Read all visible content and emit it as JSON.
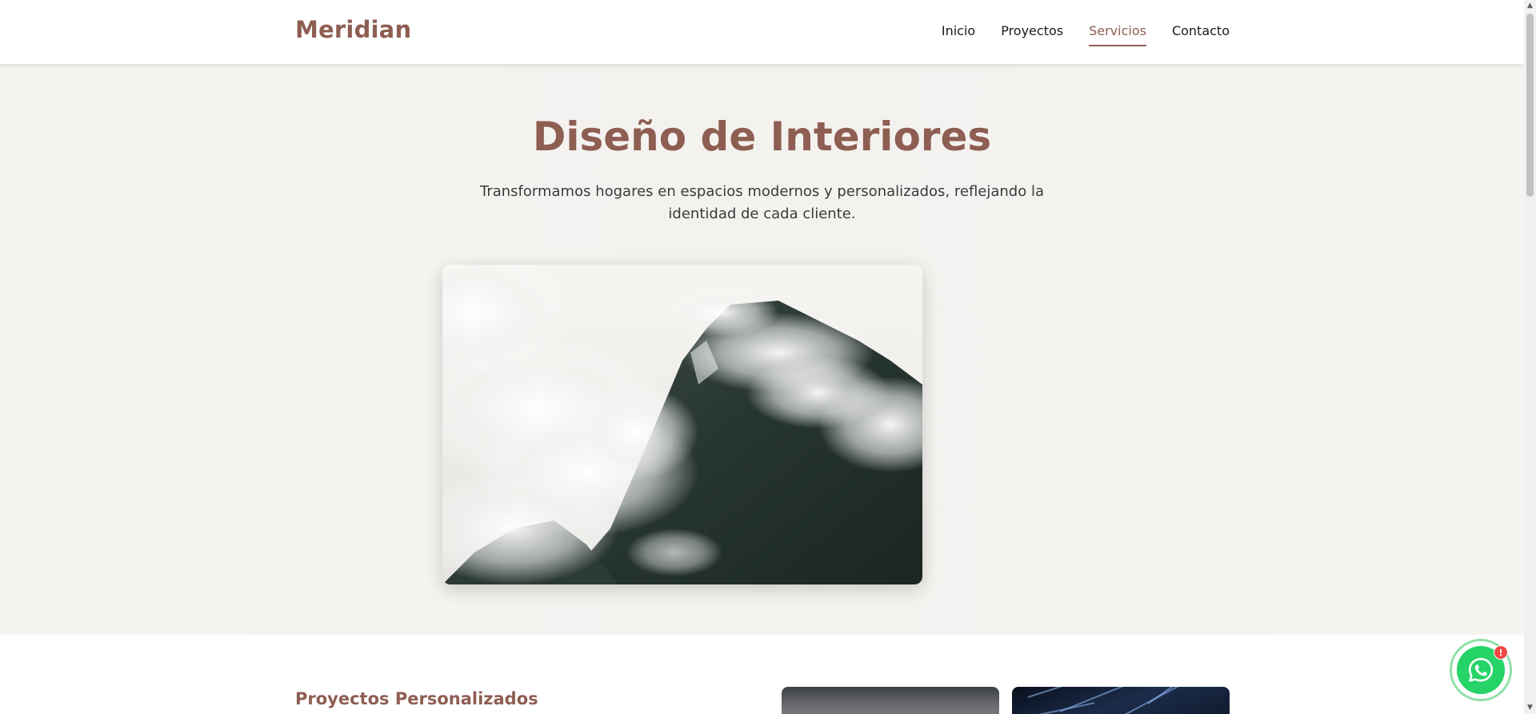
{
  "brand": {
    "name": "Meridian",
    "color": "#8e5e52"
  },
  "nav": {
    "items": [
      {
        "label": "Inicio",
        "active": false
      },
      {
        "label": "Proyectos",
        "active": false
      },
      {
        "label": "Servicios",
        "active": true
      },
      {
        "label": "Contacto",
        "active": false
      }
    ]
  },
  "hero": {
    "title": "Diseño de Interiores",
    "subtitle": "Transformamos hogares en espacios modernos y personalizados, reflejando la identidad de cada cliente."
  },
  "projects": {
    "heading": "Proyectos Personalizados"
  },
  "whatsapp": {
    "icon": "whatsapp-icon",
    "badge": "!",
    "color": "#25d366",
    "badge_color": "#ef4444"
  },
  "scrollbar": {
    "up_arrow": "▲",
    "down_arrow": "▼"
  }
}
